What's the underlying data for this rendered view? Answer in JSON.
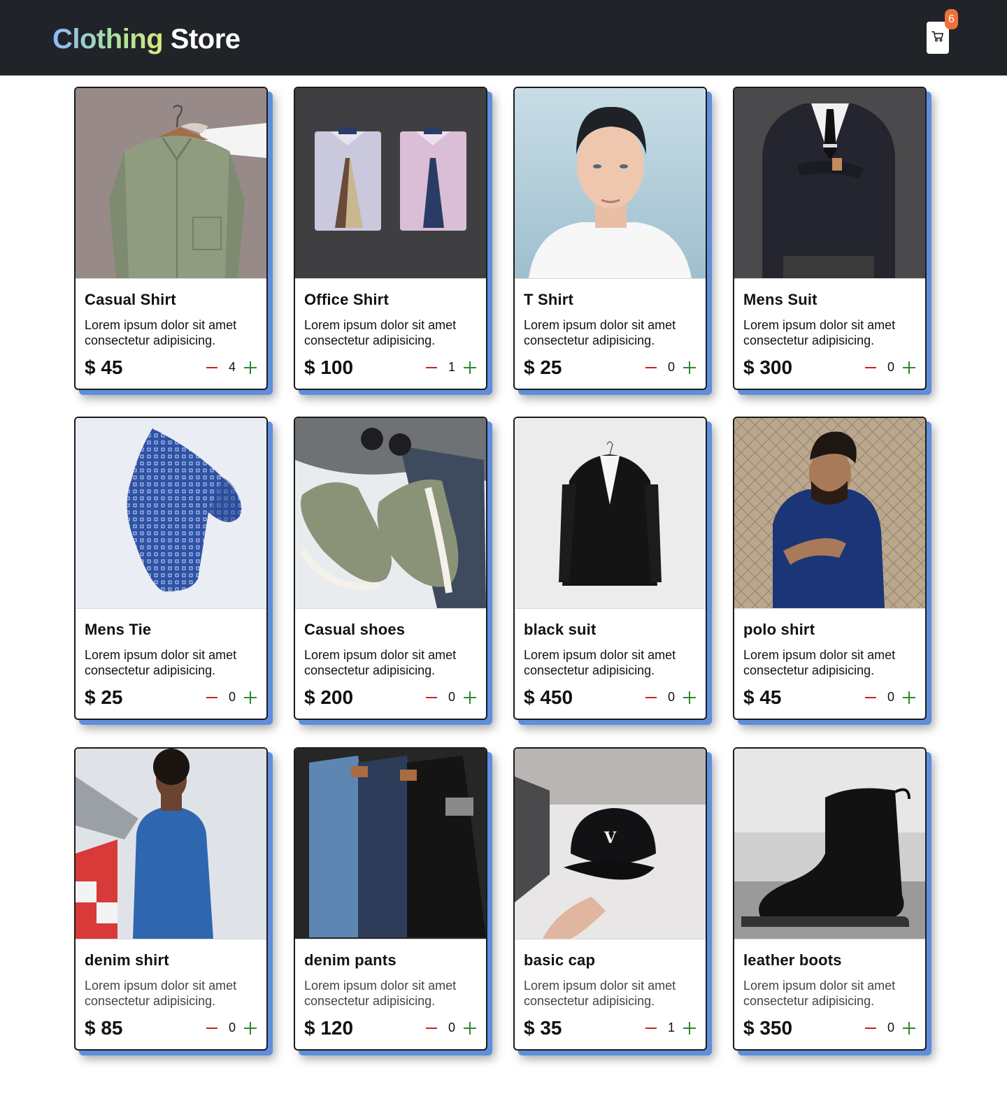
{
  "brand": {
    "part1": "Clothing",
    "part2": "Store"
  },
  "cart": {
    "count": "6",
    "icon": "cart-icon"
  },
  "colors": {
    "navbar": "#202328",
    "card_shadow": "#5f8fdc",
    "minus": "#d01f1f",
    "plus": "#2a8a2a",
    "badge": "#f0703b"
  },
  "products": [
    {
      "name": "Casual Shirt",
      "description": "Lorem ipsum dolor sit amet consectetur adipisicing.",
      "price": "$ 45",
      "quantity": "4"
    },
    {
      "name": "Office Shirt",
      "description": "Lorem ipsum dolor sit amet consectetur adipisicing.",
      "price": "$ 100",
      "quantity": "1"
    },
    {
      "name": "T Shirt",
      "description": "Lorem ipsum dolor sit amet consectetur adipisicing.",
      "price": "$ 25",
      "quantity": "0"
    },
    {
      "name": "Mens Suit",
      "description": "Lorem ipsum dolor sit amet consectetur adipisicing.",
      "price": "$ 300",
      "quantity": "0"
    },
    {
      "name": "Mens Tie",
      "description": "Lorem ipsum dolor sit amet consectetur adipisicing.",
      "price": "$ 25",
      "quantity": "0"
    },
    {
      "name": "Casual shoes",
      "description": "Lorem ipsum dolor sit amet consectetur adipisicing.",
      "price": "$ 200",
      "quantity": "0"
    },
    {
      "name": "black suit",
      "description": "Lorem ipsum dolor sit amet consectetur adipisicing.",
      "price": "$ 450",
      "quantity": "0"
    },
    {
      "name": "polo shirt",
      "description": "Lorem ipsum dolor sit amet consectetur adipisicing.",
      "price": "$ 45",
      "quantity": "0"
    },
    {
      "name": "denim shirt",
      "description": "Lorem ipsum dolor sit amet consectetur adipisicing.",
      "price": "$ 85",
      "quantity": "0"
    },
    {
      "name": "denim pants",
      "description": "Lorem ipsum dolor sit amet consectetur adipisicing.",
      "price": "$ 120",
      "quantity": "0"
    },
    {
      "name": "basic cap",
      "description": "Lorem ipsum dolor sit amet consectetur adipisicing.",
      "price": "$ 35",
      "quantity": "1"
    },
    {
      "name": "leather boots",
      "description": "Lorem ipsum dolor sit amet consectetur adipisicing.",
      "price": "$ 350",
      "quantity": "0"
    }
  ]
}
